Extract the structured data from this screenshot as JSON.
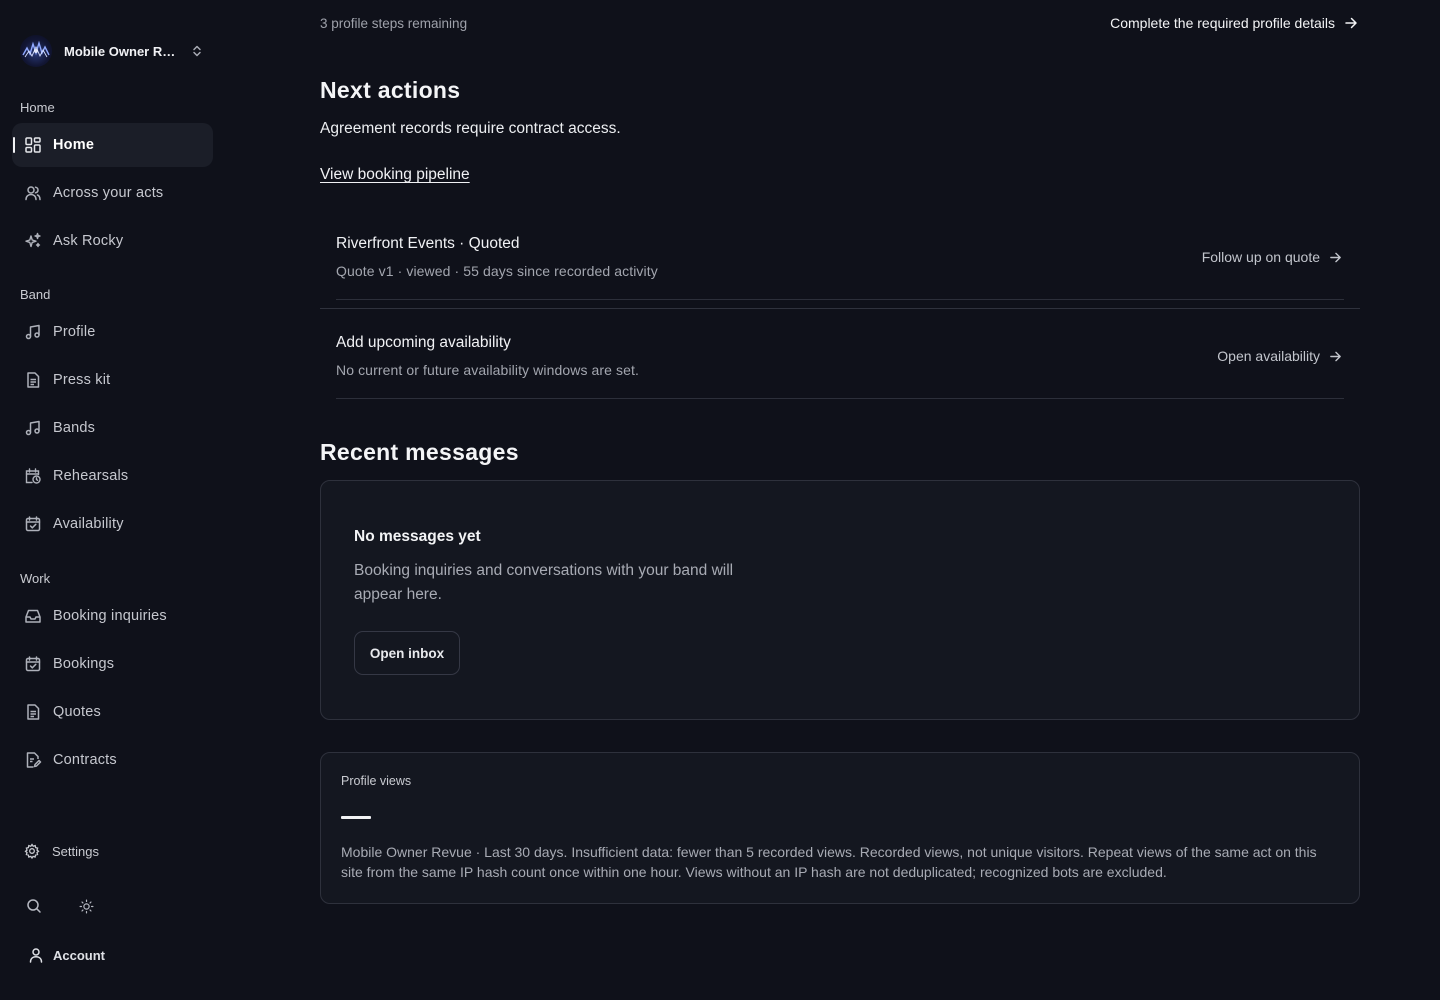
{
  "sidebar": {
    "workspace_name": "Mobile Owner Revue",
    "sections": {
      "home": "Home",
      "band": "Band",
      "work": "Work"
    },
    "items": [
      {
        "label": "Home",
        "icon": "dashboard-grid-icon",
        "active": true
      },
      {
        "label": "Across your acts",
        "icon": "users-icon"
      },
      {
        "label": "Ask Rocky",
        "icon": "sparkles-icon"
      },
      {
        "label": "Profile",
        "icon": "music-note-icon"
      },
      {
        "label": "Press kit",
        "icon": "document-icon"
      },
      {
        "label": "Bands",
        "icon": "music-note-icon"
      },
      {
        "label": "Rehearsals",
        "icon": "calendar-clock-icon"
      },
      {
        "label": "Availability",
        "icon": "calendar-check-icon"
      },
      {
        "label": "Booking inquiries",
        "icon": "inbox-icon"
      },
      {
        "label": "Bookings",
        "icon": "calendar-check-icon"
      },
      {
        "label": "Quotes",
        "icon": "document-icon"
      },
      {
        "label": "Contracts",
        "icon": "document-edit-icon"
      }
    ],
    "settings_label": "Settings",
    "account_label": "Account"
  },
  "main": {
    "steps_remaining": "3 profile steps remaining",
    "complete_link": "Complete the required profile details",
    "next_actions": {
      "heading": "Next actions",
      "lead": "Agreement records require contract access.",
      "pipeline_link": "View booking pipeline",
      "items": [
        {
          "title": "Riverfront Events · Quoted",
          "subtitle": "Quote v1 · viewed · 55 days since recorded activity",
          "cta": "Follow up on quote"
        },
        {
          "title": "Add upcoming availability",
          "subtitle": "No current or future availability windows are set.",
          "cta": "Open availability"
        }
      ]
    },
    "recent_messages": {
      "heading": "Recent messages",
      "empty_title": "No messages yet",
      "empty_description": "Booking inquiries and conversations with your band will appear here.",
      "button": "Open inbox"
    },
    "profile_views": {
      "title": "Profile views",
      "note": "Mobile Owner Revue · Last 30 days. Insufficient data: fewer than 5 recorded views. Recorded views, not unique visitors. Repeat views of the same act on this site from the same IP hash count once within one hour. Views without an IP hash are not deduplicated; recognized bots are excluded."
    }
  },
  "colors": {
    "background": "#0f111a",
    "card": "#141720",
    "border": "#2e313c",
    "active_nav": "#1b1e28",
    "text": "#e6e7eb",
    "muted": "#a8abb4"
  }
}
